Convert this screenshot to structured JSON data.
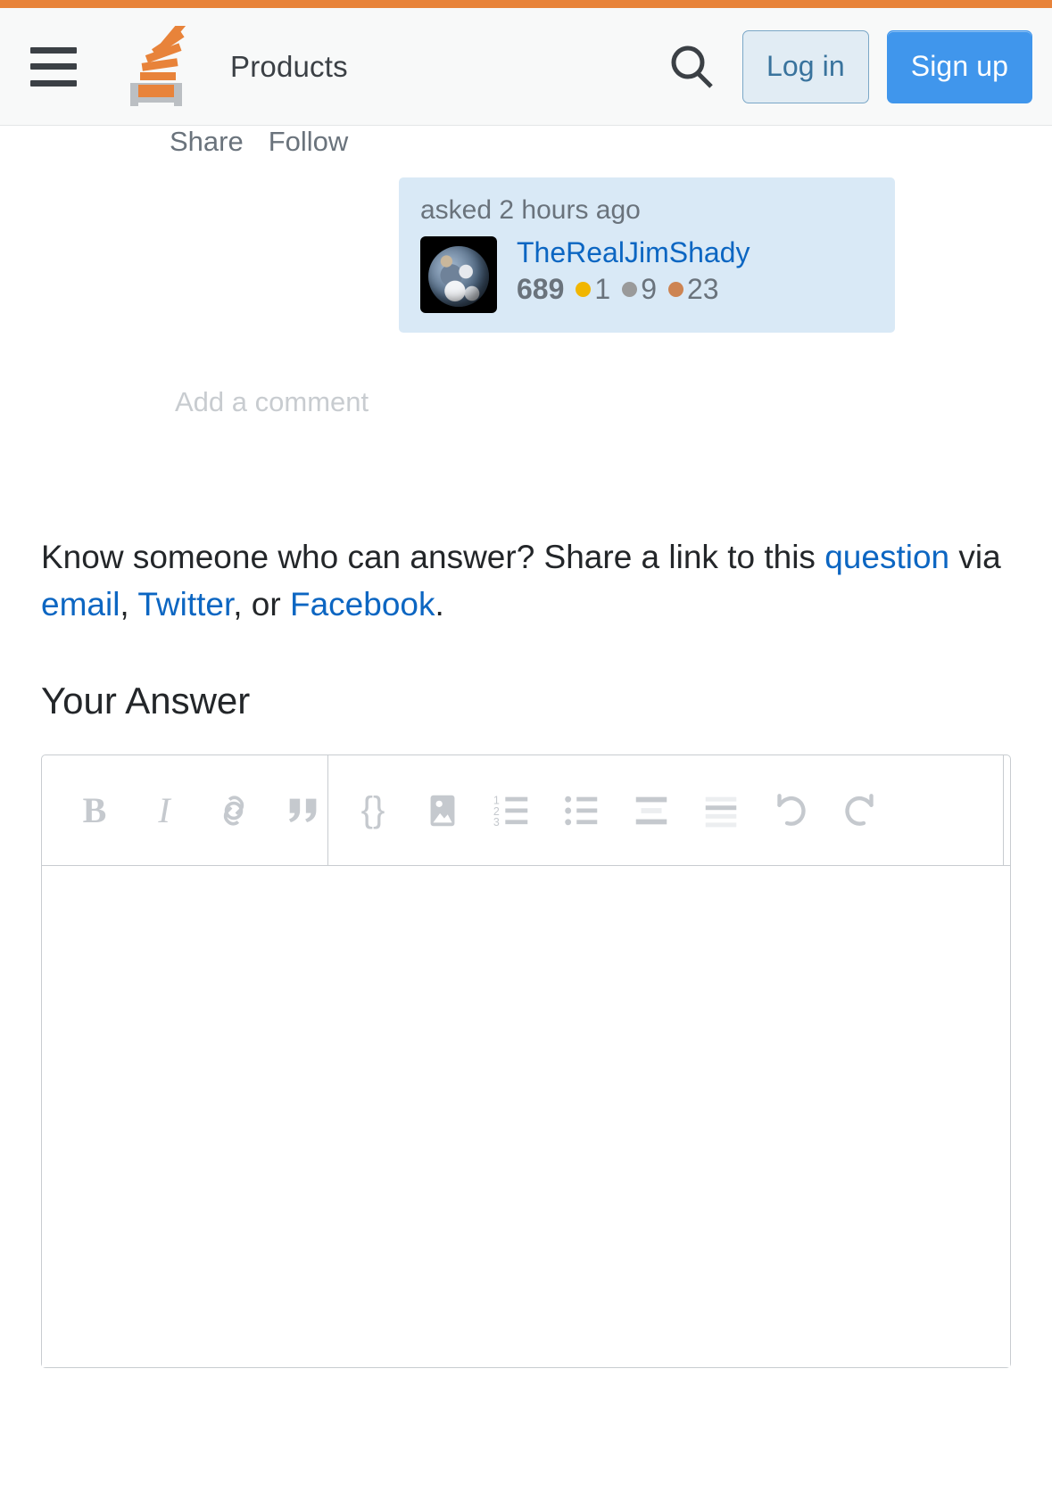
{
  "header": {
    "menu_icon": "hamburger-menu-icon",
    "logo_icon": "stack-overflow-logo-icon",
    "products_label": "Products",
    "search_icon": "search-icon",
    "login_label": "Log in",
    "signup_label": "Sign up",
    "accent_color": "#e8833a",
    "signup_color": "#4096ec",
    "login_text_color": "#39739d"
  },
  "post": {
    "share_label": "Share",
    "follow_label": "Follow",
    "add_comment_label": "Add a comment",
    "usercard": {
      "action_time": "asked 2 hours ago",
      "avatar_icon": "earth-avatar",
      "username": "TheRealJimShady",
      "reputation": "689",
      "gold_count": "1",
      "silver_count": "9",
      "bronze_count": "23",
      "gold_color": "#f1b600",
      "silver_color": "#9a9a9a",
      "bronze_color": "#cd8452",
      "card_bg": "#d9e9f6"
    }
  },
  "share_prompt": {
    "lead": "Know someone who can answer? Share a link to this ",
    "question_link": "question",
    "via": " via ",
    "email_link": "email",
    "comma1": ", ",
    "twitter_link": "Twitter",
    "or": ", or ",
    "facebook_link": "Facebook",
    "period": "."
  },
  "answer_section": {
    "heading": "Your Answer",
    "editor": {
      "placeholder": "",
      "value": "",
      "toolbar": [
        {
          "name": "bold-icon",
          "label": "B",
          "title": "Bold"
        },
        {
          "name": "italic-icon",
          "label": "I",
          "title": "Italic"
        },
        {
          "name": "link-icon",
          "label": "",
          "title": "Link"
        },
        {
          "name": "blockquote-icon",
          "label": "",
          "title": "Blockquote"
        },
        {
          "name": "code-icon",
          "label": "{}",
          "title": "Code"
        },
        {
          "name": "image-icon",
          "label": "",
          "title": "Image"
        },
        {
          "name": "numbered-list-icon",
          "label": "",
          "title": "Numbered list"
        },
        {
          "name": "bulleted-list-icon",
          "label": "",
          "title": "Bulleted list"
        },
        {
          "name": "heading-icon",
          "label": "",
          "title": "Heading"
        },
        {
          "name": "horizontal-rule-icon",
          "label": "",
          "title": "Horizontal rule"
        },
        {
          "name": "undo-icon",
          "label": "",
          "title": "Undo"
        },
        {
          "name": "redo-icon",
          "label": "",
          "title": "Redo"
        }
      ]
    }
  }
}
